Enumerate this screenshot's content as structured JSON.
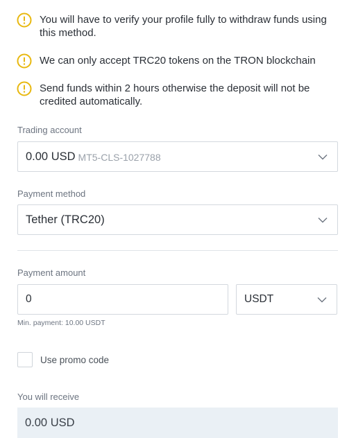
{
  "notices": [
    {
      "icon": "warning-circle-icon",
      "text": "You will have to verify your profile fully to withdraw funds using this method."
    },
    {
      "icon": "warning-circle-icon",
      "text": "We can only accept TRC20 tokens on the TRON blockchain"
    },
    {
      "icon": "warning-circle-icon",
      "text": "Send funds within 2 hours otherwise the deposit will not be credited automatically."
    }
  ],
  "trading_account": {
    "label": "Trading account",
    "value": "0.00 USD",
    "account_id": "MT5-CLS-1027788"
  },
  "payment_method": {
    "label": "Payment method",
    "value": "Tether (TRC20)"
  },
  "payment_amount": {
    "label": "Payment amount",
    "value": "0",
    "currency": "USDT",
    "hint": "Min. payment: 10.00 USDT"
  },
  "promo": {
    "checkbox_label": "Use promo code",
    "checked": false
  },
  "receive": {
    "label": "You will receive",
    "value": "0.00 USD"
  },
  "colors": {
    "warning": "#e8b80f",
    "border": "#d3d8de",
    "receive_bg": "#eaf0f5"
  }
}
